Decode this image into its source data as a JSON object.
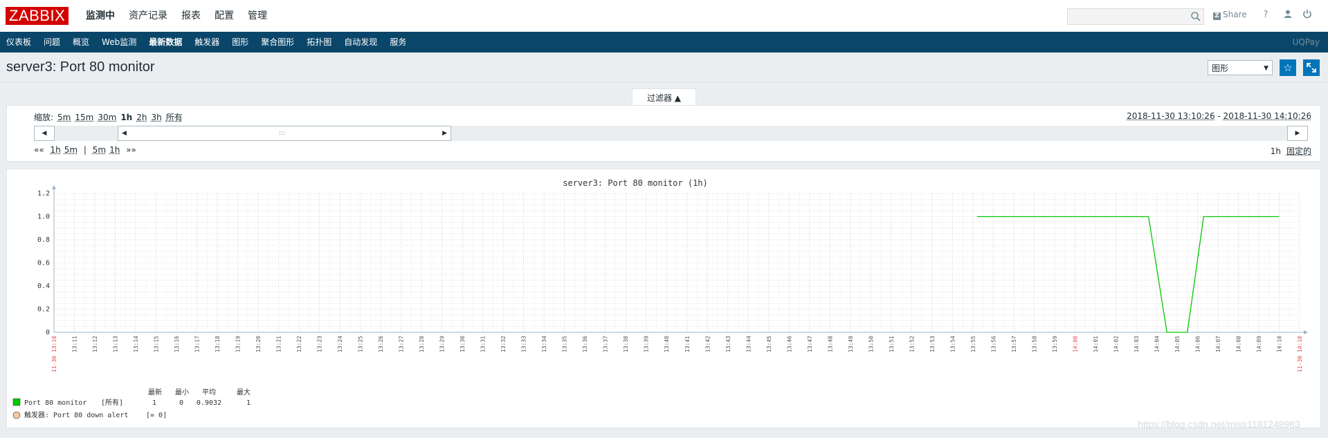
{
  "header": {
    "logo": "ZABBIX",
    "menu": [
      {
        "label": "监测中",
        "selected": true
      },
      {
        "label": "资产记录",
        "selected": false
      },
      {
        "label": "报表",
        "selected": false
      },
      {
        "label": "配置",
        "selected": false
      },
      {
        "label": "管理",
        "selected": false
      }
    ],
    "search_placeholder": "",
    "share_label": "Share",
    "help_label": "?"
  },
  "submenu": {
    "items": [
      {
        "label": "仪表板",
        "selected": false
      },
      {
        "label": "问题",
        "selected": false
      },
      {
        "label": "概览",
        "selected": false
      },
      {
        "label": "Web监测",
        "selected": false
      },
      {
        "label": "最新数据",
        "selected": true
      },
      {
        "label": "触发器",
        "selected": false
      },
      {
        "label": "图形",
        "selected": false
      },
      {
        "label": "聚合图形",
        "selected": false
      },
      {
        "label": "拓扑图",
        "selected": false
      },
      {
        "label": "自动发现",
        "selected": false
      },
      {
        "label": "服务",
        "selected": false
      }
    ],
    "server_name": "UQPay"
  },
  "page": {
    "title": "server3: Port 80 monitor",
    "view_select": "图形"
  },
  "filter": {
    "tab_label": "过滤器 ▲",
    "zoom_label": "缩放:",
    "zoom_options": [
      "5m",
      "15m",
      "30m",
      "1h",
      "2h",
      "3h",
      "所有"
    ],
    "zoom_active": "1h",
    "range_from": "2018-11-30 13:10:26",
    "range_sep": " - ",
    "range_to": "2018-11-30 14:10:26",
    "nav_back": "««",
    "nav_back_options": [
      "1h",
      "5m"
    ],
    "nav_sep": "|",
    "nav_fwd_options": [
      "5m",
      "1h"
    ],
    "nav_fwd": "»»",
    "period_label": "1h",
    "fixed_label": "固定的",
    "scroll_grip": ":::",
    "scroll_left": "◀",
    "scroll_right": "▶"
  },
  "chart_data": {
    "type": "line",
    "title": "server3: Port 80 monitor (1h)",
    "ylim": [
      0,
      1.2
    ],
    "y_ticks": [
      "1.2",
      "1.0",
      "0.8",
      "0.6",
      "0.4",
      "0.2",
      "0"
    ],
    "x_ticks": [
      "13:11",
      "13:12",
      "13:13",
      "13:14",
      "13:15",
      "13:16",
      "13:17",
      "13:18",
      "13:19",
      "13:20",
      "13:21",
      "13:22",
      "13:23",
      "13:24",
      "13:25",
      "13:26",
      "13:27",
      "13:28",
      "13:29",
      "13:30",
      "13:31",
      "13:32",
      "13:33",
      "13:34",
      "13:35",
      "13:36",
      "13:37",
      "13:38",
      "13:39",
      "13:40",
      "13:41",
      "13:42",
      "13:43",
      "13:44",
      "13:45",
      "13:46",
      "13:47",
      "13:48",
      "13:49",
      "13:50",
      "13:51",
      "13:52",
      "13:53",
      "13:54",
      "13:55",
      "13:56",
      "13:57",
      "13:58",
      "13:59",
      "14:00",
      "14:01",
      "14:02",
      "14:03",
      "14:04",
      "14:05",
      "14:06",
      "14:07",
      "14:08",
      "14:09",
      "14:10"
    ],
    "x_highlight": [
      "14:00"
    ],
    "x_start_label": "11-30 13:10",
    "x_end_label": "11-30 14:10",
    "grid": true,
    "series": [
      {
        "name": "Port 80 monitor",
        "color": "#00c800",
        "points": [
          [
            55.2,
            1
          ],
          [
            63.6,
            1
          ],
          [
            64.5,
            0
          ],
          [
            65.5,
            0
          ],
          [
            66.3,
            1
          ],
          [
            70.0,
            1
          ]
        ]
      }
    ],
    "legend": {
      "headers": [
        "最新",
        "最小",
        "平均",
        "最大"
      ],
      "items": [
        {
          "label": "Port 80 monitor",
          "scope": "[所有]",
          "last": "1",
          "min": "0",
          "avg": "0.9032",
          "max": "1",
          "color": "#00c800"
        }
      ],
      "trigger": {
        "label": "触发器: Port 80 down alert",
        "expr": "[= 0]",
        "color": "#f0c8a0"
      }
    }
  },
  "watermark": "https://blog.csdn.net/miss1181248983"
}
